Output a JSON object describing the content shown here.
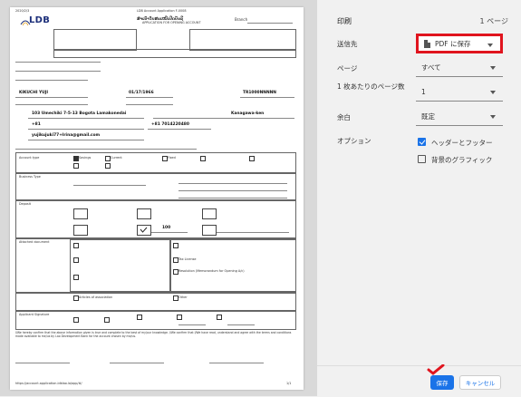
{
  "document": {
    "header_date": "2020/2/3",
    "header_title": "LDB Account Application F-0008",
    "bank_logo": "LDB",
    "title_lao": "ສຳເນົາໃບສະເໜີເປີດບັນຊີ",
    "title_en": "APPLICATION FOR OPENING ACCOUNT",
    "branch_label": "Branch",
    "fields": {
      "name_value": "KIKUCHI YUJI",
      "dob": "01/17/1966",
      "passport": "TR1000NNNNN",
      "address": "103 Umechiki 7-5-13 Bogota Lamakonedai",
      "province": "Kanagawa-ken",
      "phone_prefix": "+81",
      "mobile": "+81 7014220480",
      "email": "yujikujuki77+lrina@gmail.com",
      "amount": "100"
    },
    "section_labels": {
      "account_type": "Account type",
      "business": "Business Type",
      "deposit": "Deposit",
      "documents": "Attached document",
      "signature": "Applicant Signature"
    },
    "checkbox_texts": {
      "savings": "Savings",
      "current": "Current",
      "fixed": "Fixed",
      "tax": "Tax License",
      "resolution": "Resolution (Memorandum for Opening A/c)",
      "articles": "Articles of association",
      "other": "Other"
    },
    "declaration": "I/We hereby confirm that the above information given is true and complete to the best of my/our knowledge. I/We confirm that I/We have read, understand and agree with the terms and conditions made available to me/us by Lao Development Bank for the account chosen by me/us.",
    "footer_url": "https://account.application.ldblao.la/app/#/",
    "page_no": "1/1"
  },
  "panel": {
    "title": "印刷",
    "pages_count": "1 ページ",
    "destination_label": "送信先",
    "destination_value": "PDF に保存",
    "pages_label": "ページ",
    "pages_value": "すべて",
    "per_sheet_label": "1 枚あたりのページ数",
    "per_sheet_value": "1",
    "margins_label": "余白",
    "margins_value": "既定",
    "options_label": "オプション",
    "opt_headers": "ヘッダーとフッター",
    "opt_headers_checked": true,
    "opt_bg": "背景のグラフィック",
    "opt_bg_checked": false,
    "save_label": "保存",
    "cancel_label": "キャンセル",
    "accent": "#1a73e8",
    "highlight": "#e0141e"
  }
}
